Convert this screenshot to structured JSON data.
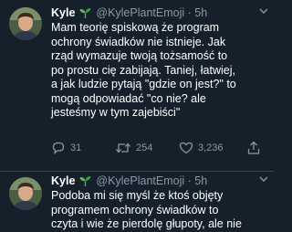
{
  "tweets": [
    {
      "name": "Kyle",
      "handle": "@KylePlantEmoji",
      "dot": "·",
      "time": "5h",
      "text": "Mam teorię spiskową że program\nochrony świadków nie istnieje. Jak\nrząd wymazuje twoją tożsamość to\npo prostu cię zabijają. Taniej, łatwiej,\na jak ludzie pytają \"gdzie on jest?\" to\nmogą odpowiadać \"co nie? ale\njesteśmy w tym zajebiści\"",
      "replies": "31",
      "retweets": "254",
      "likes": "3,236"
    },
    {
      "name": "Kyle",
      "handle": "@KylePlantEmoji",
      "dot": "·",
      "time": "5h",
      "text": "Podoba mi się myśl że ktoś objęty\nprogramem ochrony świadków to\nczyta i wie że pierdolę głupoty, ale nie"
    }
  ],
  "icons": {
    "name_emoji": "seedling-icon",
    "reply": "reply-icon",
    "retweet": "retweet-icon",
    "like": "heart-icon",
    "share": "share-icon",
    "caret": "chevron-down-icon"
  },
  "colors": {
    "background": "#15202b",
    "text": "#ffffff",
    "muted": "#8899a6",
    "divider": "#38444d"
  }
}
